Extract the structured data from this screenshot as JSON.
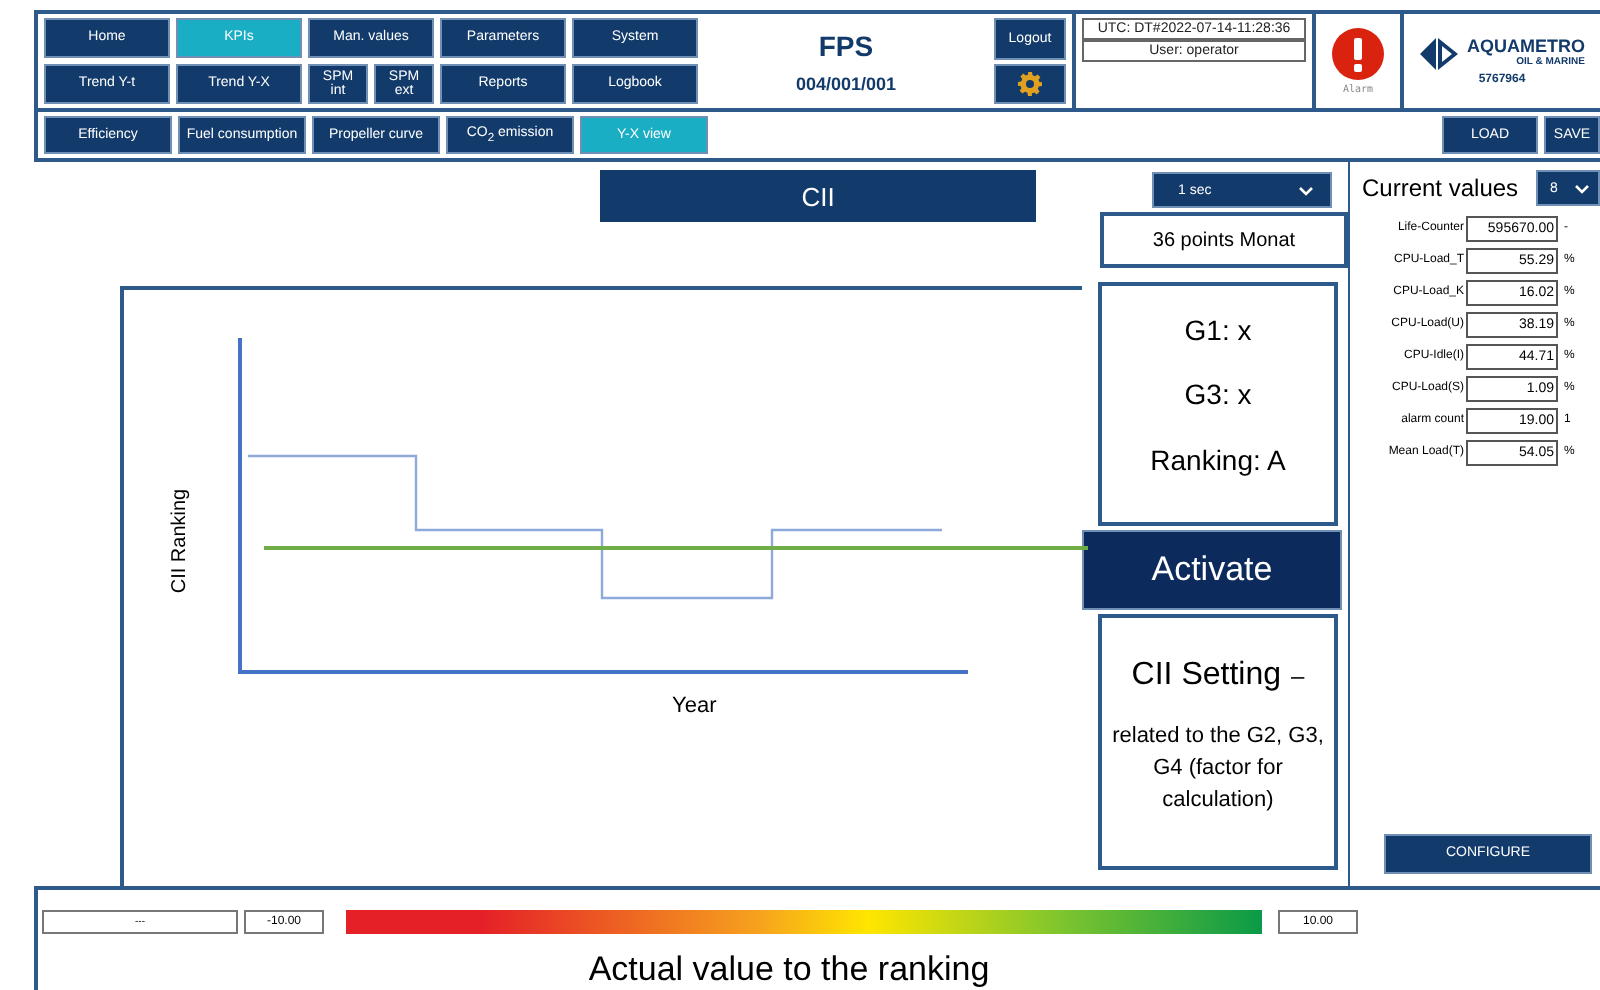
{
  "nav": [
    {
      "label": "Home",
      "selected": false
    },
    {
      "label": "KPIs",
      "selected": true
    },
    {
      "label": "Man. values",
      "selected": false
    },
    {
      "label": "Parameters",
      "selected": false
    },
    {
      "label": "System",
      "selected": false
    },
    {
      "label": "Trend Y-t",
      "selected": false
    },
    {
      "label": "Trend Y-X",
      "selected": false
    },
    {
      "label": "SPM\nint",
      "selected": false
    },
    {
      "label": "SPM\next",
      "selected": false
    },
    {
      "label": "Reports",
      "selected": false
    },
    {
      "label": "Logbook",
      "selected": false
    }
  ],
  "header": {
    "title": "FPS",
    "code": "004/001/001",
    "logout": "Logout",
    "utc": "UTC: DT#2022-07-14-11:28:36",
    "user": "User: operator",
    "alarm": "Alarm",
    "brand": "AQUAMETRO",
    "brand_sub": "OIL & MARINE",
    "serial": "5767964"
  },
  "tabs": [
    {
      "label": "Efficiency",
      "selected": false
    },
    {
      "label": "Fuel consumption",
      "selected": false
    },
    {
      "label": "Propeller curve",
      "selected": false
    },
    {
      "label": "CO$_{2}$ emission",
      "selected": false
    },
    {
      "label": "Y-X view",
      "selected": true
    }
  ],
  "actions": [
    "LOAD",
    "SAVE"
  ],
  "chart": {
    "title": "CII",
    "ylabel": "CII Ranking",
    "xlabel": "Year"
  },
  "interval": "1 sec",
  "points": "36 points Monat",
  "grades": [
    "G1: x",
    "G3: x",
    "Ranking: A"
  ],
  "activate": "Activate",
  "setting": {
    "title": "CII Setting",
    "dash": "–",
    "text": "related to the G2, G3, G4 (factor for calculation)"
  },
  "current": {
    "title": "Current values",
    "select": "8",
    "configure": "CONFIGURE",
    "rows": [
      {
        "label": "Life-Counter",
        "value": "595670.00",
        "unit": "-"
      },
      {
        "label": "CPU-Load_T",
        "value": "55.29",
        "unit": "%"
      },
      {
        "label": "CPU-Load_K",
        "value": "16.02",
        "unit": "%"
      },
      {
        "label": "CPU-Load(U)",
        "value": "38.19",
        "unit": "%"
      },
      {
        "label": "CPU-Idle(I)",
        "value": "44.71",
        "unit": "%"
      },
      {
        "label": "CPU-Load(S)",
        "value": "1.09",
        "unit": "%"
      },
      {
        "label": "alarm count",
        "value": "19.00",
        "unit": "1"
      },
      {
        "label": "Mean Load(T)",
        "value": "54.05",
        "unit": "%"
      }
    ]
  },
  "scale": {
    "field": "---",
    "min": "-10.00",
    "max": "10.00",
    "caption": "Actual value to the ranking"
  }
}
